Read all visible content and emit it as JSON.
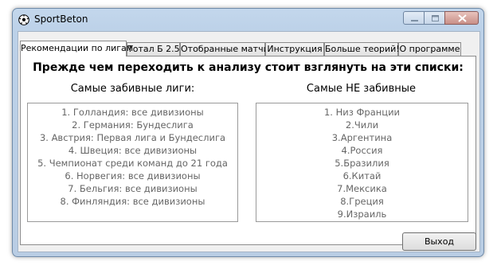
{
  "window": {
    "title": "SportBeton",
    "icon": "soccer-ball-icon"
  },
  "tabs": [
    {
      "label": "Рекомендации по лигам",
      "active": true
    },
    {
      "label": "Тотал Б 2.5",
      "active": false
    },
    {
      "label": "Отобранные матчи",
      "active": false
    },
    {
      "label": "Инструкция",
      "active": false
    },
    {
      "label": "Больше теорий!",
      "active": false
    },
    {
      "label": "О программе",
      "active": false
    }
  ],
  "panel": {
    "heading": "Прежде чем переходить к анализу стоит взглянуть на эти списки:",
    "left_title": "Самые забивные лиги:",
    "right_title": "Самые НЕ забивные",
    "left_items": [
      "1. Голландия: все дивизионы",
      "2. Германия: Бундеслига",
      "3. Австрия: Первая лига и Бундеслига",
      "4. Швеция: все дивизионы",
      "5. Чемпионат среди команд до 21 года",
      "6. Норвегия: все дивизионы",
      "7. Бельгия: все дивизионы",
      "8. Финляндия: все дивизионы"
    ],
    "right_items": [
      "1. Низ Франции",
      "2.Чили",
      "3.Аргентина",
      "4.Россия",
      "5.Бразилия",
      "6.Китай",
      "7.Мексика",
      "8.Греция",
      "9.Израиль"
    ]
  },
  "buttons": {
    "exit": "Выход"
  },
  "colors": {
    "frame": "#bcd1e8",
    "list_text": "#666666",
    "close_button": "#c98f87"
  }
}
